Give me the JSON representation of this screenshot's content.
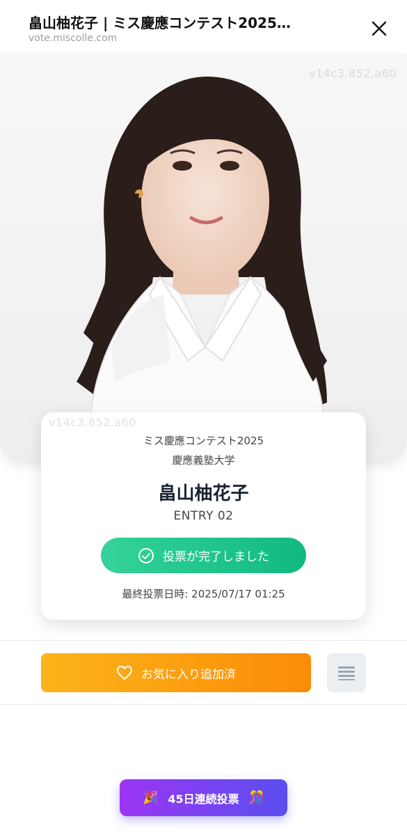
{
  "browser": {
    "page_title": "畠山柚花子 | ミス慶應コンテスト2025…",
    "url": "vote.miscolle.com",
    "close_icon": "close-icon"
  },
  "photo": {
    "watermark_top": "v14c3.852.a60",
    "watermark_bottom": "v14c3.852.a60"
  },
  "card": {
    "contest": "ミス慶應コンテスト2025",
    "university": "慶應義塾大学",
    "name": "畠山柚花子",
    "entry": "ENTRY 02",
    "vote_status": "投票が完了しました",
    "last_vote": "最終投票日時: 2025/07/17 01:25"
  },
  "actions": {
    "favorite_label": "お気に入り追加済",
    "favorite_icon": "heart-icon",
    "menu_icon": "menu-icon"
  },
  "streak": {
    "label": "45日連続投票",
    "left_emoji": "🎉",
    "right_emoji": "🎊"
  },
  "colors": {
    "vote_green_start": "#34d399",
    "vote_green_end": "#10b981",
    "favorite_orange_start": "#fbb41a",
    "favorite_orange_end": "#fb8c07",
    "streak_purple_start": "#9b35f3",
    "streak_purple_end": "#5a4ff0"
  }
}
